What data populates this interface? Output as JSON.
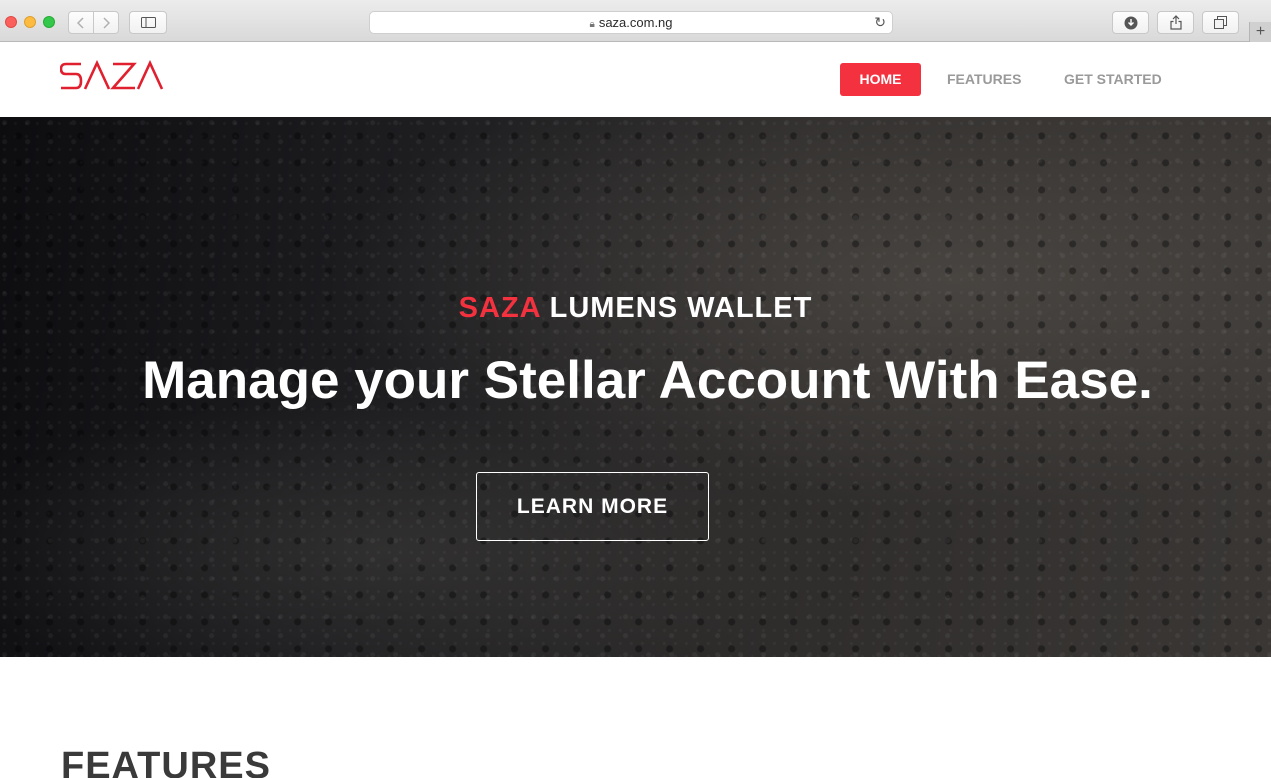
{
  "browser": {
    "url": "saza.com.ng",
    "icons": {
      "back": "chevron-left-icon",
      "forward": "chevron-right-icon",
      "sidebar": "sidebar-icon",
      "lock": "lock-icon",
      "reload": "reload-icon",
      "download": "download-icon",
      "share": "share-icon",
      "tabs": "tabs-overview-icon",
      "new_tab": "plus-icon"
    }
  },
  "site": {
    "logo": "SAZA",
    "nav": {
      "home": "HOME",
      "features": "FEATURES",
      "get_started": "GET STARTED"
    },
    "colors": {
      "accent": "#f4313f",
      "logo": "#e0202e"
    }
  },
  "hero": {
    "eyebrow_brand": "SAZA",
    "eyebrow_rest": "LUMENS WALLET",
    "title": "Manage your Stellar Account With Ease.",
    "cta": "LEARN MORE"
  },
  "features": {
    "heading": "FEATURES"
  }
}
